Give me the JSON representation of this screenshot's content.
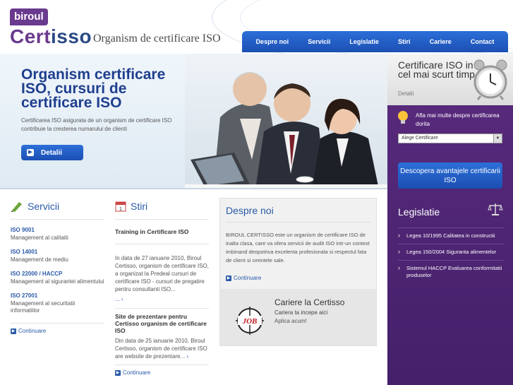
{
  "logo": {
    "biroul": "biroul",
    "cert": "Cert",
    "isso": "isso"
  },
  "tagline": "Organism de certificare ISO",
  "nav": [
    "Despre noi",
    "Servicii",
    "Legislatie",
    "Stiri",
    "Cariere",
    "Contact"
  ],
  "hero": {
    "title": "Organism certificare ISO, cursuri de certificare ISO",
    "description": "Certificarea ISO asigurata de un organism de certificare ISO contribuie la cresterea numarului de clienti",
    "button": "Detalii"
  },
  "sidebar": {
    "cert_title": "Certificare ISO in cel mai scurt timp",
    "cert_link": "Detalii",
    "info": "Afla mai multe despre certificarea dorita",
    "select_value": "Alege Certificare",
    "discover": "Descopera avantajele certificarii ISO",
    "legislatie_title": "Legislatie",
    "legislatie_items": [
      "Legea 10/1995 Calitatea in constructii",
      "Legea 150/2004 Siguranta alimentelor",
      "Sistemul HACCP Evaluarea conformitatii produselor"
    ]
  },
  "servicii": {
    "title": "Servicii",
    "items": [
      {
        "code": "ISO 9001",
        "desc": "Management al calitatii"
      },
      {
        "code": "ISO 14001",
        "desc": "Management de mediu"
      },
      {
        "code": "ISO 22000 / HACCP",
        "desc": "Management al sigurantei alimentului"
      },
      {
        "code": "ISO 27001",
        "desc": "Management al securitatii informatiilor"
      }
    ],
    "more": "Continuare"
  },
  "stiri": {
    "title": "Stiri",
    "items": [
      {
        "title": "Training in Certificare ISO",
        "body": "In data de 27 ianuarie 2010, Biroul Certisso, organism de certificare ISO, a organizat la Predeal cursuri de certificare ISO - cursuri de pregatire pentru consultanti ISO...",
        "more": "..."
      },
      {
        "title": "Site de prezentare pentru Certisso organism de certificare ISO",
        "body": "Din data de 25 ianuarie 2010, Biroul Certisso, organism de certificare ISO are website de prezentare..."
      }
    ],
    "more": "Continuare"
  },
  "despre": {
    "title": "Despre noi",
    "text": "BIROUL CERTISSO este un organism de certificare ISO de inalta clasa, care va ofera servicii de audit ISO intr-un context imbinand deopotriva excelenta profesionala si respectul fata de client si cerintele sale.",
    "more": "Continuare"
  },
  "cariere": {
    "title": "Cariere la Certisso",
    "subtitle": "Cariera ta incepe aici",
    "apply": "Aplica acum!",
    "logo_text": "JOB"
  },
  "colors": {
    "primary": "#1f3f8f",
    "accent_blue": "#2c6fd8",
    "purple": "#5a2b7e"
  }
}
